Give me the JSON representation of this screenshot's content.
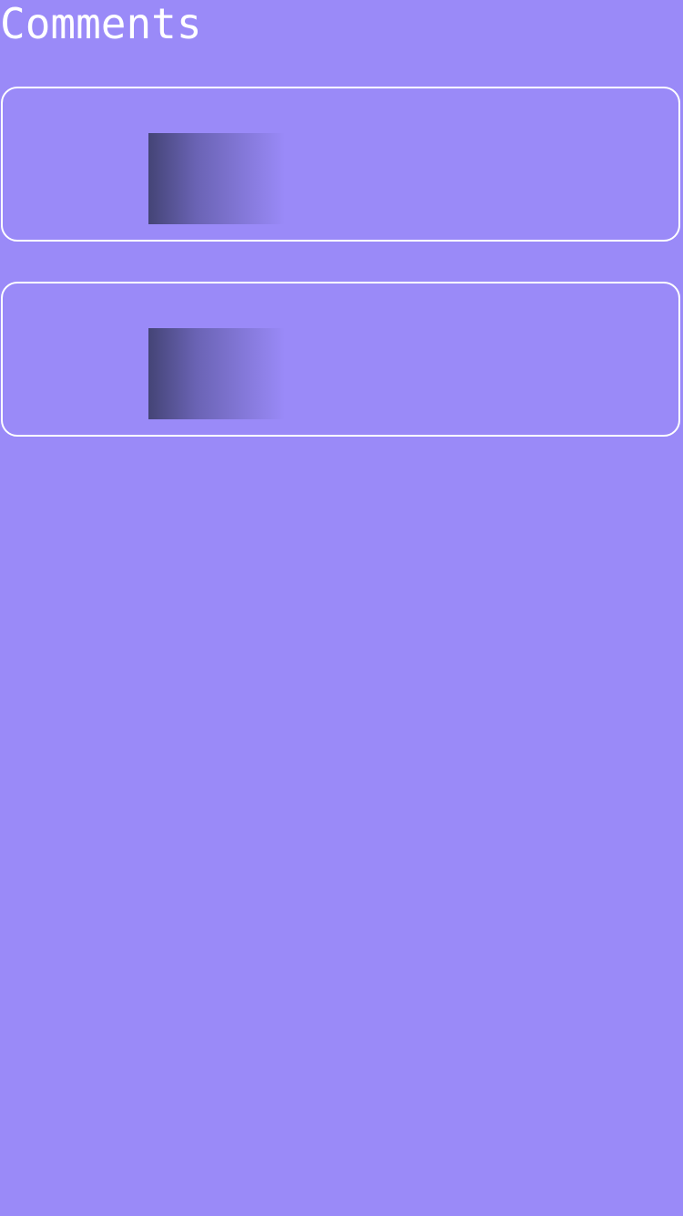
{
  "header": {
    "title": "Comments"
  },
  "colors": {
    "background": "#9a8af8",
    "card_border": "#ffffff",
    "thumbnail_gradient_start": "#444476",
    "title_text": "#ffffff"
  },
  "comments": [
    {
      "thumbnail": "image-placeholder"
    },
    {
      "thumbnail": "image-placeholder"
    }
  ]
}
